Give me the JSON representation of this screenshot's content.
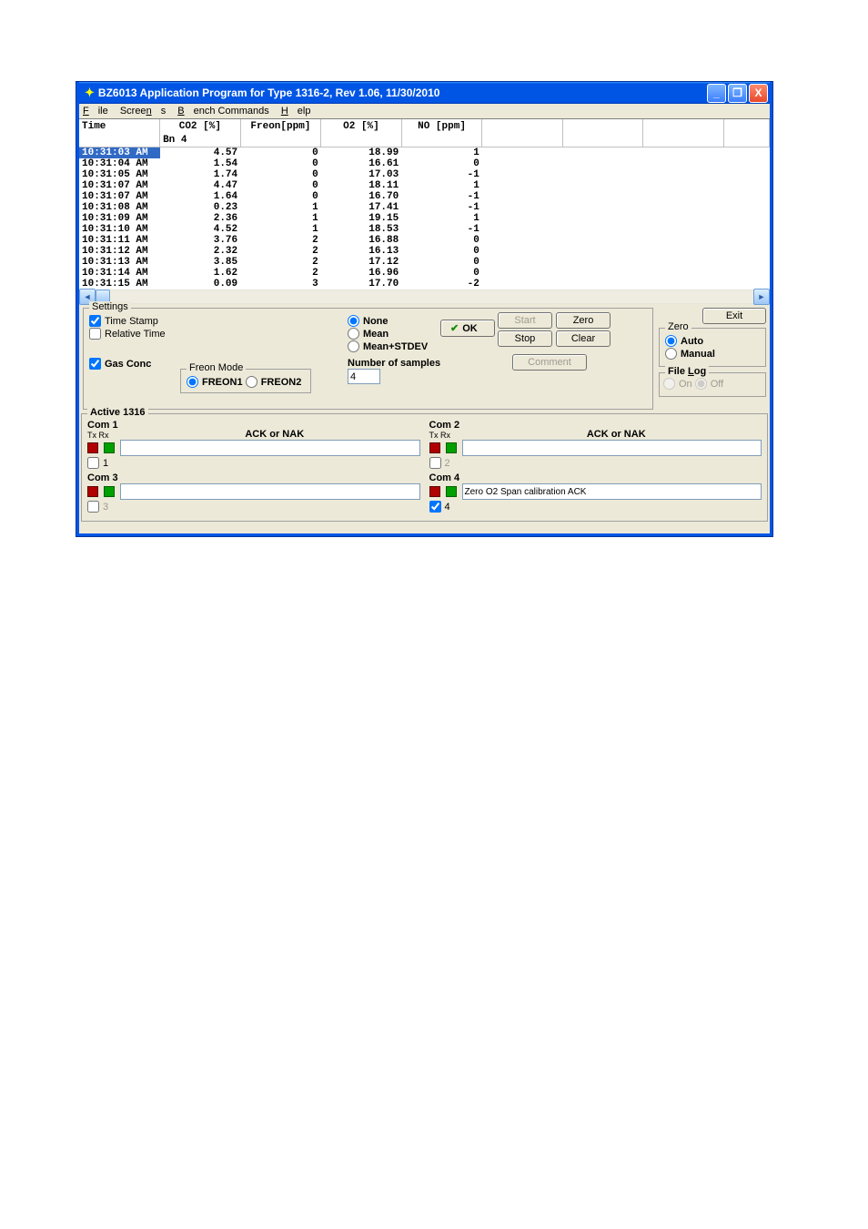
{
  "window": {
    "title": "BZ6013 Application Program for Type 1316-2, Rev 1.06, 11/30/2010"
  },
  "menu": {
    "file": "File",
    "screens": "Screens",
    "bench": "Bench Commands",
    "help": "Help"
  },
  "columns": [
    "Time",
    "CO2 [%]",
    "Freon[ppm]",
    "O2 [%]",
    "NO [ppm]",
    "",
    "",
    "",
    ""
  ],
  "subheader": [
    "",
    "Bn 4",
    "",
    "",
    "",
    "",
    "",
    "",
    ""
  ],
  "rows": [
    {
      "t": "10:31:03 AM",
      "c": [
        "4.57",
        "0",
        "18.99",
        "1"
      ],
      "sel": true
    },
    {
      "t": "10:31:04 AM",
      "c": [
        "1.54",
        "0",
        "16.61",
        "0"
      ]
    },
    {
      "t": "10:31:05 AM",
      "c": [
        "1.74",
        "0",
        "17.03",
        "-1"
      ]
    },
    {
      "t": "10:31:07 AM",
      "c": [
        "4.47",
        "0",
        "18.11",
        "1"
      ]
    },
    {
      "t": "10:31:07 AM",
      "c": [
        "1.64",
        "0",
        "16.70",
        "-1"
      ]
    },
    {
      "t": "10:31:08 AM",
      "c": [
        "0.23",
        "1",
        "17.41",
        "-1"
      ]
    },
    {
      "t": "10:31:09 AM",
      "c": [
        "2.36",
        "1",
        "19.15",
        "1"
      ]
    },
    {
      "t": "10:31:10 AM",
      "c": [
        "4.52",
        "1",
        "18.53",
        "-1"
      ]
    },
    {
      "t": "10:31:11 AM",
      "c": [
        "3.76",
        "2",
        "16.88",
        "0"
      ]
    },
    {
      "t": "10:31:12 AM",
      "c": [
        "2.32",
        "2",
        "16.13",
        "0"
      ]
    },
    {
      "t": "10:31:13 AM",
      "c": [
        "3.85",
        "2",
        "17.12",
        "0"
      ]
    },
    {
      "t": "10:31:14 AM",
      "c": [
        "1.62",
        "2",
        "16.96",
        "0"
      ]
    },
    {
      "t": "10:31:15 AM",
      "c": [
        "0.09",
        "3",
        "17.70",
        "-2"
      ]
    }
  ],
  "settings": {
    "legend": "Settings",
    "timestamp": "Time Stamp",
    "reltime": "Relative Time",
    "gasconc": "Gas Conc",
    "freonmode": {
      "legend": "Freon Mode",
      "f1": "FREON1",
      "f2": "FREON2"
    },
    "stats": {
      "none": "None",
      "mean": "Mean",
      "ms": "Mean+STDEV",
      "nsamp": "Number of samples",
      "nval": "4"
    },
    "ok": "OK"
  },
  "buttons": {
    "start": "Start",
    "zero": "Zero",
    "stop": "Stop",
    "clear": "Clear",
    "comment": "Comment",
    "exit": "Exit"
  },
  "zero": {
    "legend": "Zero",
    "auto": "Auto",
    "manual": "Manual"
  },
  "filelog": {
    "legend": "File Log",
    "on": "On",
    "off": "Off"
  },
  "active": {
    "legend": "Active 1316",
    "ack": "ACK or NAK",
    "txrx": "Tx Rx",
    "com1": "Com 1",
    "com2": "Com 2",
    "com3": "Com 3",
    "com4": "Com 4",
    "n1": "1",
    "n2": "2",
    "n3": "3",
    "n4": "4",
    "msg4": "Zero O2 Span calibration  ACK"
  }
}
